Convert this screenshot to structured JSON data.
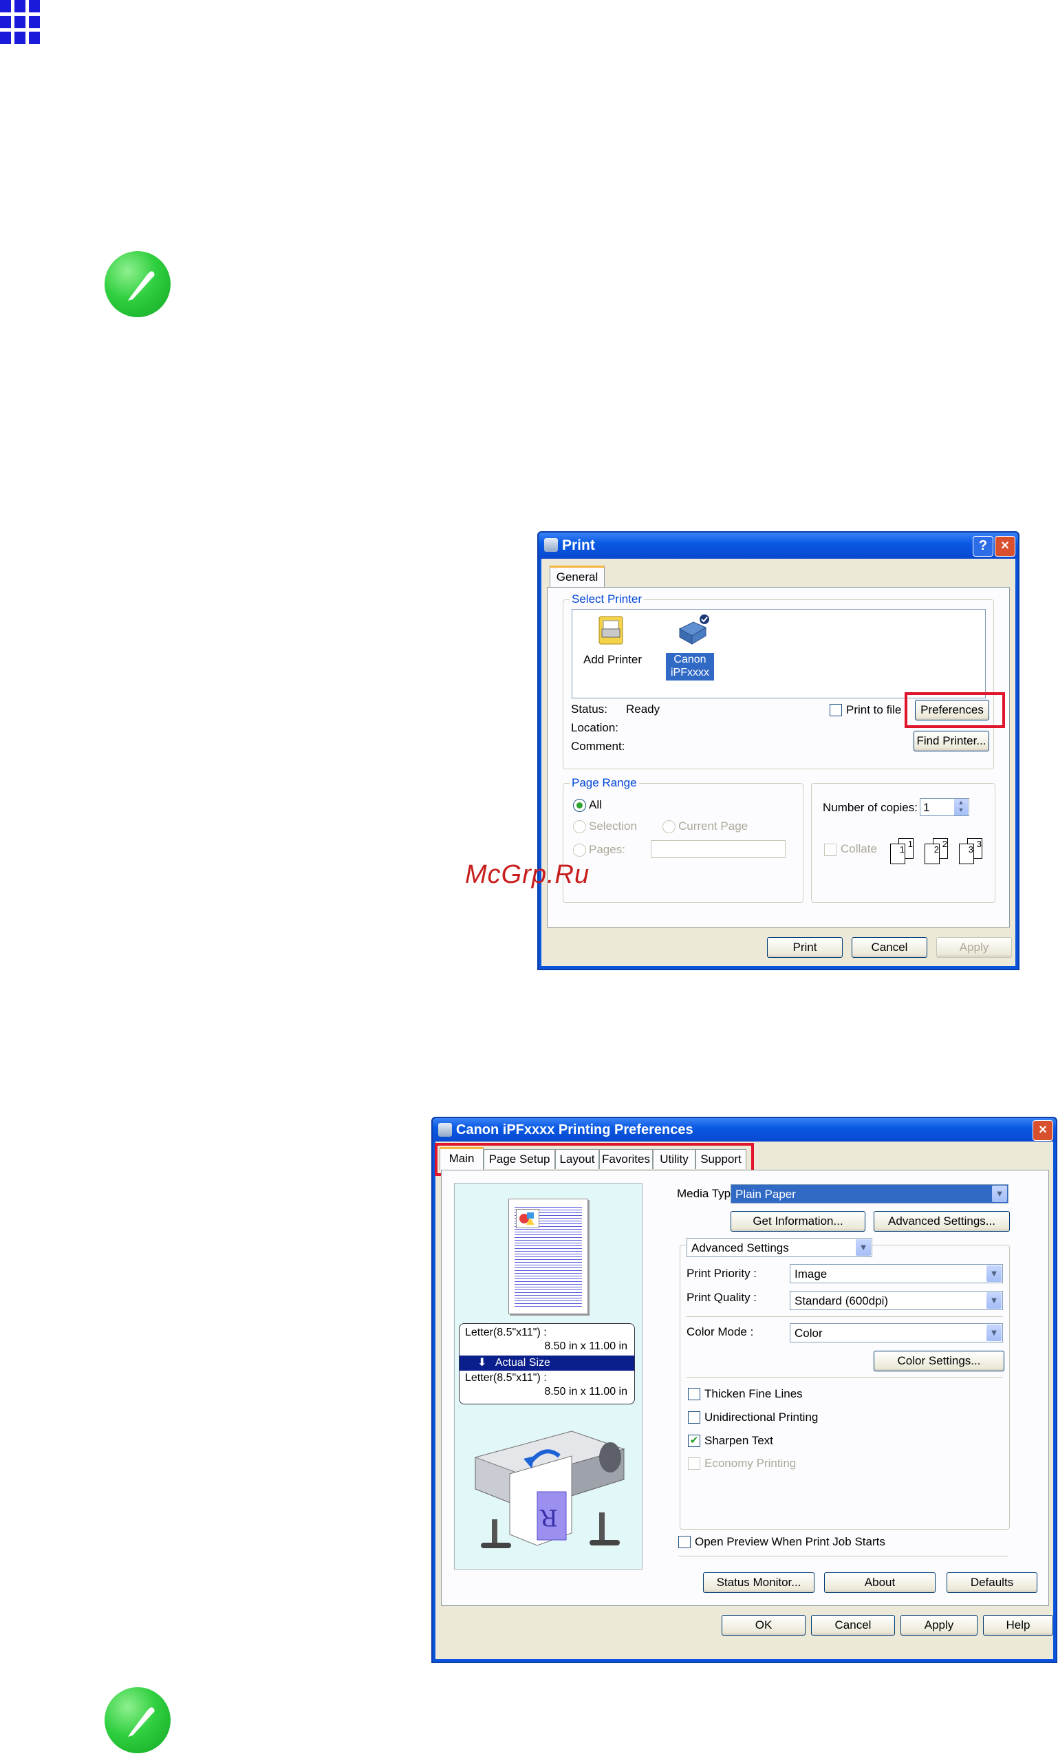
{
  "watermark": "McGrp.Ru",
  "print_dialog": {
    "title": "Print",
    "help_button": "?",
    "close_button": "×",
    "tab": "General",
    "select_printer": {
      "label": "Select Printer",
      "items": [
        {
          "label": "Add Printer",
          "icon": "add-printer-icon",
          "selected": false
        },
        {
          "label": "Canon iPFxxxx",
          "icon": "printer-icon",
          "selected": true
        }
      ]
    },
    "status_label": "Status:",
    "status_value": "Ready",
    "location_label": "Location:",
    "comment_label": "Comment:",
    "print_to_file": "Print to file",
    "preferences_button": "Preferences",
    "find_printer_button": "Find Printer...",
    "page_range": {
      "label": "Page Range",
      "all": "All",
      "selection": "Selection",
      "current_page": "Current Page",
      "pages": "Pages:",
      "selected": "All"
    },
    "copies_label": "Number of copies:",
    "copies_value": "1",
    "collate": "Collate",
    "collate_pages": [
      "1",
      "1",
      "2",
      "2",
      "3",
      "3"
    ],
    "print_button": "Print",
    "cancel_button": "Cancel",
    "apply_button": "Apply"
  },
  "prefs_dialog": {
    "title": "Canon iPFxxxx Printing Preferences",
    "close_button": "×",
    "tabs": [
      "Main",
      "Page Setup",
      "Layout",
      "Favorites",
      "Utility",
      "Support"
    ],
    "active_tab": "Main",
    "paper_info": {
      "line1": "Letter(8.5\"x11\") :",
      "line2": "8.50 in x 11.00 in",
      "actual_size": "Actual Size",
      "line3": "Letter(8.5\"x11\") :",
      "line4": "8.50 in x 11.00 in"
    },
    "media_type_label": "Media Type :",
    "media_type_value": "Plain Paper",
    "get_information_button": "Get Information...",
    "advanced_settings_button": "Advanced Settings...",
    "settings_mode": "Advanced Settings",
    "print_priority_label": "Print Priority :",
    "print_priority_value": "Image",
    "print_quality_label": "Print Quality :",
    "print_quality_value": "Standard (600dpi)",
    "color_mode_label": "Color Mode :",
    "color_mode_value": "Color",
    "color_settings_button": "Color Settings...",
    "checkboxes": [
      {
        "label": "Thicken Fine Lines",
        "checked": false,
        "enabled": true
      },
      {
        "label": "Unidirectional Printing",
        "checked": false,
        "enabled": true
      },
      {
        "label": "Sharpen Text",
        "checked": true,
        "enabled": true
      },
      {
        "label": "Economy Printing",
        "checked": false,
        "enabled": false
      }
    ],
    "open_preview": "Open Preview When Print Job Starts",
    "status_monitor_button": "Status Monitor...",
    "about_button": "About",
    "defaults_button": "Defaults",
    "ok_button": "OK",
    "cancel_button": "Cancel",
    "apply_button": "Apply",
    "help_button": "Help"
  },
  "colors": {
    "title_bar": "#0a5ae4",
    "highlight_box": "#e0142a",
    "note_icon": "#2fcf3f",
    "grid_icon": "#1a1adb",
    "watermark": "#c81d1d"
  }
}
